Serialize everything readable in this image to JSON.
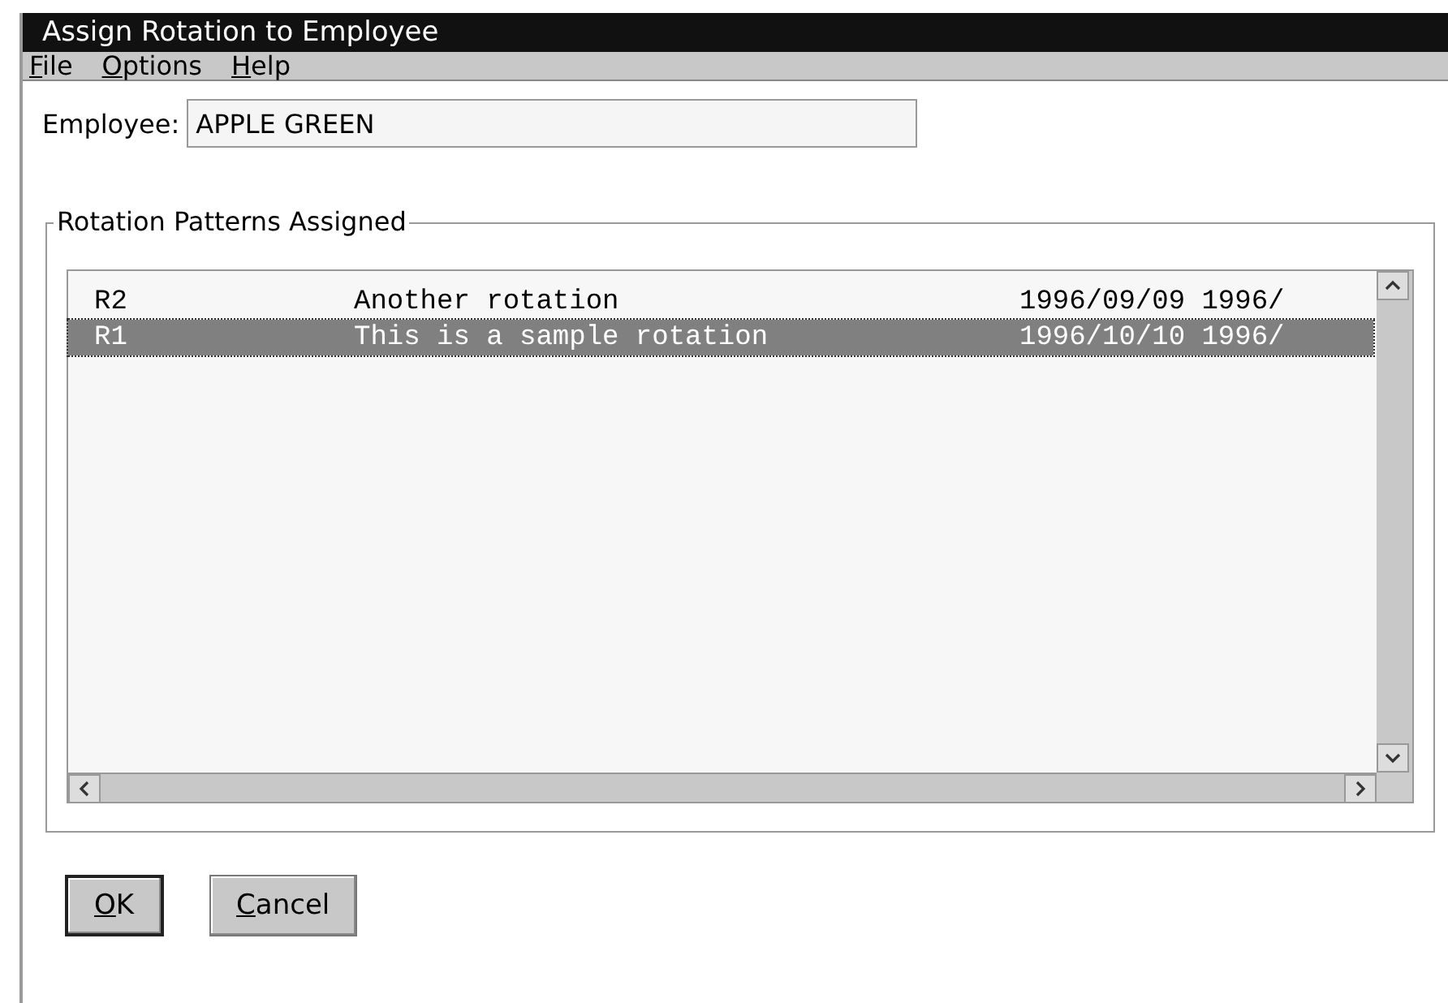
{
  "window": {
    "title": "Assign Rotation to Employee"
  },
  "menu": [
    "File",
    "Options",
    "Help"
  ],
  "employee": {
    "label": "Employee:",
    "value": "APPLE GREEN"
  },
  "group": {
    "title": "Rotation Patterns Assigned"
  },
  "rows": [
    {
      "code": "R2",
      "description": "Another rotation",
      "dates": "1996/09/09 1996/",
      "selected": false
    },
    {
      "code": "R1",
      "description": "This is a sample rotation",
      "dates": "1996/10/10 1996/",
      "selected": true
    }
  ],
  "buttons": [
    {
      "label": "OK",
      "default": true
    },
    {
      "label": "Cancel",
      "default": false
    }
  ]
}
